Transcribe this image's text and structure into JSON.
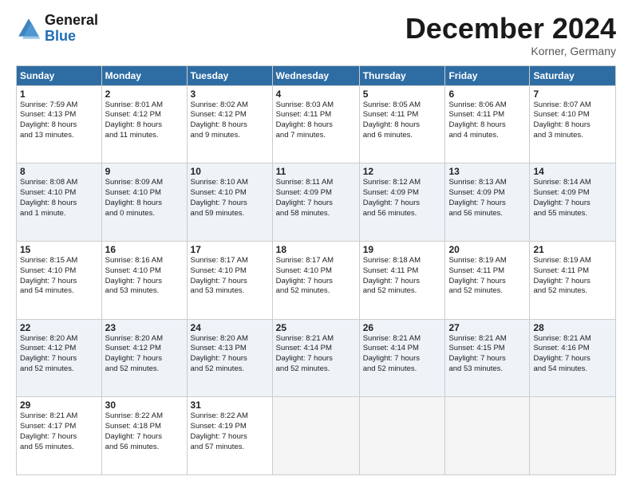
{
  "header": {
    "logo_line1": "General",
    "logo_line2": "Blue",
    "month": "December 2024",
    "location": "Korner, Germany"
  },
  "weekdays": [
    "Sunday",
    "Monday",
    "Tuesday",
    "Wednesday",
    "Thursday",
    "Friday",
    "Saturday"
  ],
  "weeks": [
    [
      {
        "day": "1",
        "info": "Sunrise: 7:59 AM\nSunset: 4:13 PM\nDaylight: 8 hours\nand 13 minutes."
      },
      {
        "day": "2",
        "info": "Sunrise: 8:01 AM\nSunset: 4:12 PM\nDaylight: 8 hours\nand 11 minutes."
      },
      {
        "day": "3",
        "info": "Sunrise: 8:02 AM\nSunset: 4:12 PM\nDaylight: 8 hours\nand 9 minutes."
      },
      {
        "day": "4",
        "info": "Sunrise: 8:03 AM\nSunset: 4:11 PM\nDaylight: 8 hours\nand 7 minutes."
      },
      {
        "day": "5",
        "info": "Sunrise: 8:05 AM\nSunset: 4:11 PM\nDaylight: 8 hours\nand 6 minutes."
      },
      {
        "day": "6",
        "info": "Sunrise: 8:06 AM\nSunset: 4:11 PM\nDaylight: 8 hours\nand 4 minutes."
      },
      {
        "day": "7",
        "info": "Sunrise: 8:07 AM\nSunset: 4:10 PM\nDaylight: 8 hours\nand 3 minutes."
      }
    ],
    [
      {
        "day": "8",
        "info": "Sunrise: 8:08 AM\nSunset: 4:10 PM\nDaylight: 8 hours\nand 1 minute."
      },
      {
        "day": "9",
        "info": "Sunrise: 8:09 AM\nSunset: 4:10 PM\nDaylight: 8 hours\nand 0 minutes."
      },
      {
        "day": "10",
        "info": "Sunrise: 8:10 AM\nSunset: 4:10 PM\nDaylight: 7 hours\nand 59 minutes."
      },
      {
        "day": "11",
        "info": "Sunrise: 8:11 AM\nSunset: 4:09 PM\nDaylight: 7 hours\nand 58 minutes."
      },
      {
        "day": "12",
        "info": "Sunrise: 8:12 AM\nSunset: 4:09 PM\nDaylight: 7 hours\nand 56 minutes."
      },
      {
        "day": "13",
        "info": "Sunrise: 8:13 AM\nSunset: 4:09 PM\nDaylight: 7 hours\nand 56 minutes."
      },
      {
        "day": "14",
        "info": "Sunrise: 8:14 AM\nSunset: 4:09 PM\nDaylight: 7 hours\nand 55 minutes."
      }
    ],
    [
      {
        "day": "15",
        "info": "Sunrise: 8:15 AM\nSunset: 4:10 PM\nDaylight: 7 hours\nand 54 minutes."
      },
      {
        "day": "16",
        "info": "Sunrise: 8:16 AM\nSunset: 4:10 PM\nDaylight: 7 hours\nand 53 minutes."
      },
      {
        "day": "17",
        "info": "Sunrise: 8:17 AM\nSunset: 4:10 PM\nDaylight: 7 hours\nand 53 minutes."
      },
      {
        "day": "18",
        "info": "Sunrise: 8:17 AM\nSunset: 4:10 PM\nDaylight: 7 hours\nand 52 minutes."
      },
      {
        "day": "19",
        "info": "Sunrise: 8:18 AM\nSunset: 4:11 PM\nDaylight: 7 hours\nand 52 minutes."
      },
      {
        "day": "20",
        "info": "Sunrise: 8:19 AM\nSunset: 4:11 PM\nDaylight: 7 hours\nand 52 minutes."
      },
      {
        "day": "21",
        "info": "Sunrise: 8:19 AM\nSunset: 4:11 PM\nDaylight: 7 hours\nand 52 minutes."
      }
    ],
    [
      {
        "day": "22",
        "info": "Sunrise: 8:20 AM\nSunset: 4:12 PM\nDaylight: 7 hours\nand 52 minutes."
      },
      {
        "day": "23",
        "info": "Sunrise: 8:20 AM\nSunset: 4:12 PM\nDaylight: 7 hours\nand 52 minutes."
      },
      {
        "day": "24",
        "info": "Sunrise: 8:20 AM\nSunset: 4:13 PM\nDaylight: 7 hours\nand 52 minutes."
      },
      {
        "day": "25",
        "info": "Sunrise: 8:21 AM\nSunset: 4:14 PM\nDaylight: 7 hours\nand 52 minutes."
      },
      {
        "day": "26",
        "info": "Sunrise: 8:21 AM\nSunset: 4:14 PM\nDaylight: 7 hours\nand 52 minutes."
      },
      {
        "day": "27",
        "info": "Sunrise: 8:21 AM\nSunset: 4:15 PM\nDaylight: 7 hours\nand 53 minutes."
      },
      {
        "day": "28",
        "info": "Sunrise: 8:21 AM\nSunset: 4:16 PM\nDaylight: 7 hours\nand 54 minutes."
      }
    ],
    [
      {
        "day": "29",
        "info": "Sunrise: 8:21 AM\nSunset: 4:17 PM\nDaylight: 7 hours\nand 55 minutes."
      },
      {
        "day": "30",
        "info": "Sunrise: 8:22 AM\nSunset: 4:18 PM\nDaylight: 7 hours\nand 56 minutes."
      },
      {
        "day": "31",
        "info": "Sunrise: 8:22 AM\nSunset: 4:19 PM\nDaylight: 7 hours\nand 57 minutes."
      },
      {
        "day": "",
        "info": ""
      },
      {
        "day": "",
        "info": ""
      },
      {
        "day": "",
        "info": ""
      },
      {
        "day": "",
        "info": ""
      }
    ]
  ]
}
